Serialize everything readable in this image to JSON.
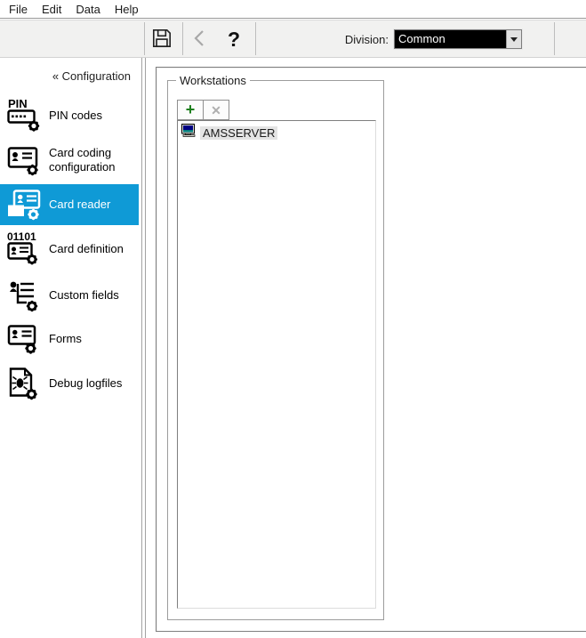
{
  "window": {
    "menu_items": [
      "File",
      "Edit",
      "Data",
      "Help"
    ]
  },
  "toolbar": {
    "help_glyph": "?",
    "division_label": "Division:",
    "division_value": "Common"
  },
  "sidebar": {
    "header": "« Configuration",
    "items": [
      {
        "label": "PIN codes",
        "icon": "pin-codes-icon",
        "selected": false
      },
      {
        "label": "Card coding configuration",
        "icon": "card-coding-configuration-icon",
        "selected": false
      },
      {
        "label": "Card reader",
        "icon": "card-reader-icon",
        "selected": true
      },
      {
        "label": "Card definition",
        "icon": "card-definition-icon",
        "selected": false
      },
      {
        "label": "Custom fields",
        "icon": "custom-fields-icon",
        "selected": false
      },
      {
        "label": "Forms",
        "icon": "forms-icon",
        "selected": false
      },
      {
        "label": "Debug logfiles",
        "icon": "debug-logfiles-icon",
        "selected": false
      }
    ]
  },
  "main": {
    "groupbox_title": "Workstations",
    "add_button_glyph": "+",
    "delete_button_glyph": "✕",
    "workstations": [
      {
        "name": "AMSSERVER",
        "icon": "workstation-computer-icon"
      }
    ]
  },
  "colors": {
    "selection_blue": "#0F9AD6",
    "add_green": "#1B7E1B",
    "disabled_gray": "#AFAFAF",
    "screen_navy": "#000082",
    "screen_teal": "#008080"
  }
}
